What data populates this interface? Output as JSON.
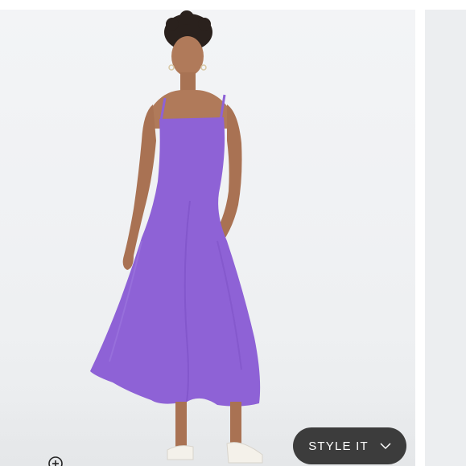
{
  "product_gallery": {
    "style_it_button": {
      "label": "STYLE IT",
      "icon": "chevron-down-icon"
    },
    "zoom_button": {
      "icon": "zoom-in-icon"
    },
    "dress_color": "#8e62d6",
    "button_color": "#3c3c3c"
  }
}
